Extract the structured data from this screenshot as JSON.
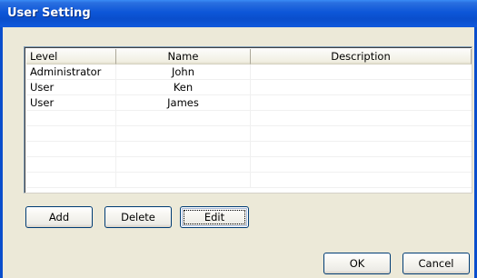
{
  "window": {
    "title": "User Setting"
  },
  "listview": {
    "columns": [
      "Level",
      "Name",
      "Description"
    ],
    "rows": [
      [
        "Administrator",
        "John",
        ""
      ],
      [
        "User",
        "Ken",
        ""
      ],
      [
        "User",
        "James",
        ""
      ],
      [
        "",
        "",
        ""
      ],
      [
        "",
        "",
        ""
      ],
      [
        "",
        "",
        ""
      ],
      [
        "",
        "",
        ""
      ],
      [
        "",
        "",
        ""
      ]
    ]
  },
  "buttons": {
    "add": "Add",
    "delete": "Delete",
    "edit": "Edit",
    "ok": "OK",
    "cancel": "Cancel"
  },
  "colors": {
    "titlebar": "#0a4ecc",
    "dialog_bg": "#ece9d8",
    "button_border": "#003c74"
  }
}
